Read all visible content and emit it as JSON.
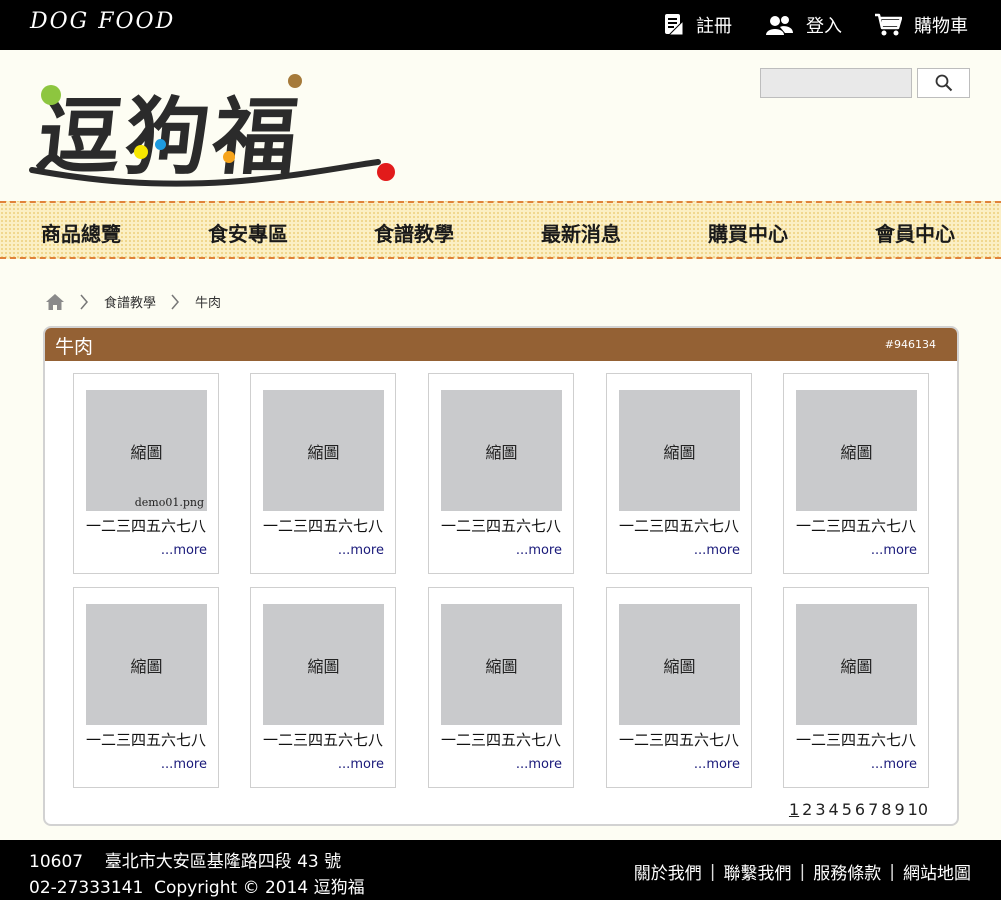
{
  "topbar": {
    "brand": "DOG  FOOD",
    "register": "註冊",
    "login": "登入",
    "cart": "購物車"
  },
  "header": {
    "logo_text": "逗狗福",
    "search": {
      "value": "",
      "placeholder": ""
    }
  },
  "nav": [
    "商品總覽",
    "食安專區",
    "食譜教學",
    "最新消息",
    "購買中心",
    "會員中心"
  ],
  "breadcrumb": [
    "食譜教學",
    "牛肉"
  ],
  "panel": {
    "title": "牛肉",
    "color_code": "#946134",
    "cards": [
      {
        "thumb": "縮圖",
        "file": "demo01.png",
        "title": "一二三四五六七八",
        "more": "...more"
      },
      {
        "thumb": "縮圖",
        "file": "",
        "title": "一二三四五六七八",
        "more": "...more"
      },
      {
        "thumb": "縮圖",
        "file": "",
        "title": "一二三四五六七八",
        "more": "...more"
      },
      {
        "thumb": "縮圖",
        "file": "",
        "title": "一二三四五六七八",
        "more": "...more"
      },
      {
        "thumb": "縮圖",
        "file": "",
        "title": "一二三四五六七八",
        "more": "...more"
      },
      {
        "thumb": "縮圖",
        "file": "",
        "title": "一二三四五六七八",
        "more": "...more"
      },
      {
        "thumb": "縮圖",
        "file": "",
        "title": "一二三四五六七八",
        "more": "...more"
      },
      {
        "thumb": "縮圖",
        "file": "",
        "title": "一二三四五六七八",
        "more": "...more"
      },
      {
        "thumb": "縮圖",
        "file": "",
        "title": "一二三四五六七八",
        "more": "...more"
      },
      {
        "thumb": "縮圖",
        "file": "",
        "title": "一二三四五六七八",
        "more": "...more"
      }
    ],
    "pagination": {
      "pages": [
        "1",
        "2",
        "3",
        "4",
        "5",
        "6",
        "7",
        "8",
        "9",
        "10"
      ],
      "current": 1
    }
  },
  "footer": {
    "line1": "10607    臺北市大安區基隆路四段 43 號",
    "line2": "02-27333141  Copyright © 2014 逗狗福",
    "links": [
      "關於我們",
      "聯繫我們",
      "服務條款",
      "網站地圖"
    ]
  },
  "colors": {
    "topbar": "#000000",
    "page_bg": "#fdfdf3",
    "nav_bg": "#fbefc4",
    "nav_border": "#e0823a",
    "panel_head": "#946134",
    "thumb": "#c9cacc",
    "more_link": "#1a1a7a"
  },
  "icons": {
    "register": "document-icon",
    "login": "users-icon",
    "cart": "cart-icon",
    "search": "search-icon",
    "home": "home-icon",
    "separator": "chevron-right-icon"
  }
}
